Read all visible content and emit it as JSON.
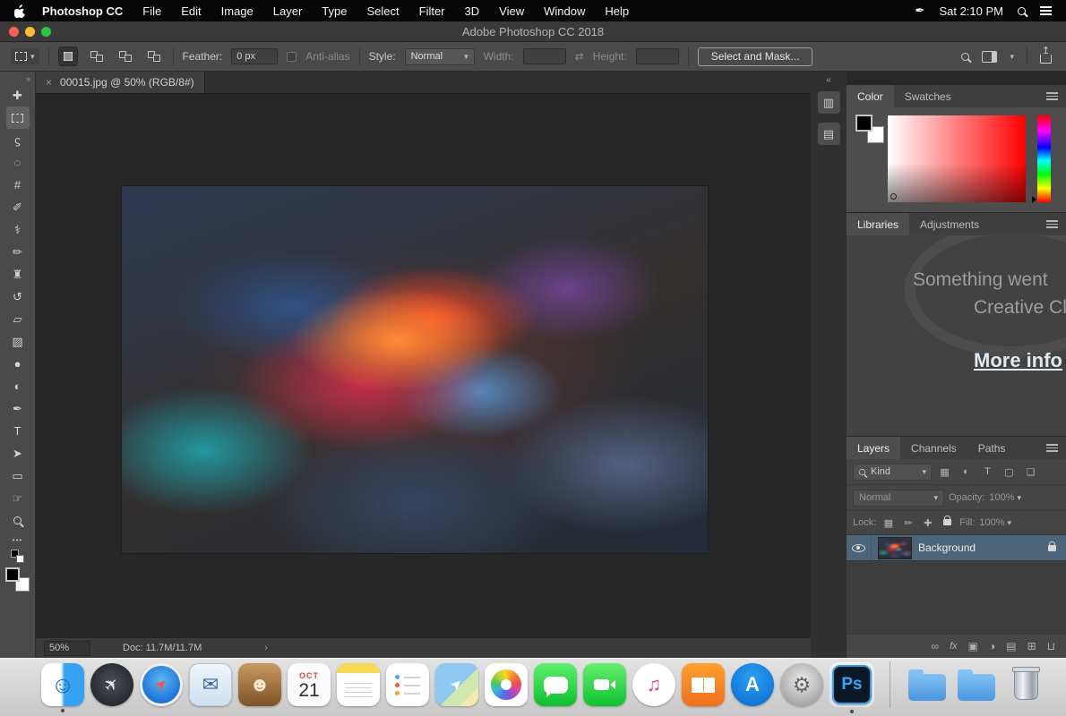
{
  "menubar": {
    "app_name": "Photoshop CC",
    "menus": [
      "File",
      "Edit",
      "Image",
      "Layer",
      "Type",
      "Select",
      "Filter",
      "3D",
      "View",
      "Window",
      "Help"
    ],
    "clock": "Sat 2:10 PM"
  },
  "window": {
    "title": "Adobe Photoshop CC 2018"
  },
  "options_bar": {
    "feather_label": "Feather:",
    "feather_value": "0 px",
    "antialias_label": "Anti-alias",
    "style_label": "Style:",
    "style_value": "Normal",
    "width_label": "Width:",
    "width_value": "",
    "height_label": "Height:",
    "height_value": "",
    "select_and_mask": "Select and Mask..."
  },
  "tools": [
    {
      "name": "move-tool",
      "glyph": "✚"
    },
    {
      "name": "rectangular-marquee-tool",
      "glyph": "▢",
      "selected": true
    },
    {
      "name": "lasso-tool",
      "glyph": "ϛ"
    },
    {
      "name": "quick-selection-tool",
      "glyph": "◌"
    },
    {
      "name": "crop-tool",
      "glyph": "#"
    },
    {
      "name": "eyedropper-tool",
      "glyph": "✐"
    },
    {
      "name": "healing-brush-tool",
      "glyph": "⚕"
    },
    {
      "name": "brush-tool",
      "glyph": "✏"
    },
    {
      "name": "clone-stamp-tool",
      "glyph": "♜"
    },
    {
      "name": "history-brush-tool",
      "glyph": "↺"
    },
    {
      "name": "eraser-tool",
      "glyph": "▱"
    },
    {
      "name": "gradient-tool",
      "glyph": "▨"
    },
    {
      "name": "blur-tool",
      "glyph": "●"
    },
    {
      "name": "dodge-tool",
      "glyph": "◐"
    },
    {
      "name": "pen-tool",
      "glyph": "✒"
    },
    {
      "name": "type-tool",
      "glyph": "T"
    },
    {
      "name": "path-selection-tool",
      "glyph": "➤"
    },
    {
      "name": "rectangle-tool",
      "glyph": "▭"
    },
    {
      "name": "hand-tool",
      "glyph": "☞"
    },
    {
      "name": "zoom-tool"
    }
  ],
  "document": {
    "tab_title": "00015.jpg @ 50% (RGB/8#)",
    "zoom_level": "50%",
    "doc_size": "Doc: 11.7M/11.7M"
  },
  "color_panel": {
    "tabs": [
      "Color",
      "Swatches"
    ]
  },
  "libraries_panel": {
    "tabs": [
      "Libraries",
      "Adjustments"
    ],
    "message_line1": "Something went",
    "message_line2": "Creative Clo",
    "more_info": "More info"
  },
  "layers_panel": {
    "tabs": [
      "Layers",
      "Channels",
      "Paths"
    ],
    "filter_label": "Kind",
    "blend_mode": "Normal",
    "opacity_label": "Opacity:",
    "opacity_value": "100%",
    "lock_label": "Lock:",
    "fill_label": "Fill:",
    "fill_value": "100%",
    "layer": {
      "name": "Background",
      "locked": true,
      "visible": true
    },
    "footer_fx": "fx"
  },
  "icons": {
    "double_chevron_right": "»",
    "double_chevron_left": "«",
    "chevron_down": "▾",
    "close": "×",
    "status_arrow": "›",
    "link_dims": "⇄",
    "ellipsis": "•••",
    "panel_button_top": "▥",
    "panel_button_bottom": "▤",
    "filter_pixel": "▦",
    "filter_adjust": "◐",
    "filter_type": "T",
    "filter_shape": "▢",
    "filter_smart": "❏",
    "lock_transparent": "▦",
    "lock_pixels": "✏",
    "lock_position": "✚",
    "footer_link": "∞",
    "footer_mask": "▣",
    "footer_adjust": "◑",
    "footer_group": "▤",
    "footer_new": "⊞",
    "footer_trash": "⊔",
    "share_arrow": "↥",
    "pen_extra": "✒"
  },
  "dock": {
    "items": [
      {
        "name": "finder",
        "glyph": "☺",
        "running": true
      },
      {
        "name": "launchpad",
        "glyph": "✈"
      },
      {
        "name": "safari",
        "glyph": "➤"
      },
      {
        "name": "mail",
        "glyph": "✉"
      },
      {
        "name": "contacts",
        "glyph": "☻"
      },
      {
        "name": "calendar",
        "month": "OCT",
        "day": "21"
      },
      {
        "name": "notes"
      },
      {
        "name": "reminders"
      },
      {
        "name": "maps",
        "glyph": "➤"
      },
      {
        "name": "photos"
      },
      {
        "name": "messages"
      },
      {
        "name": "facetime"
      },
      {
        "name": "itunes",
        "glyph": "♫"
      },
      {
        "name": "books"
      },
      {
        "name": "app-store",
        "glyph": "A"
      },
      {
        "name": "system-preferences",
        "glyph": "⚙"
      },
      {
        "name": "photoshop",
        "glyph": "Ps",
        "active": true,
        "running": true
      },
      {
        "name": "downloads-folder"
      },
      {
        "name": "documents-folder"
      },
      {
        "name": "trash"
      }
    ]
  },
  "colors": {
    "ps_accent_blue": "#31a8ff",
    "selected_layer_bg": "#4d6579",
    "more_info_color": "#dde9ee",
    "menubar_bg": "#060606",
    "panel_bg": "#4a4a4a"
  }
}
